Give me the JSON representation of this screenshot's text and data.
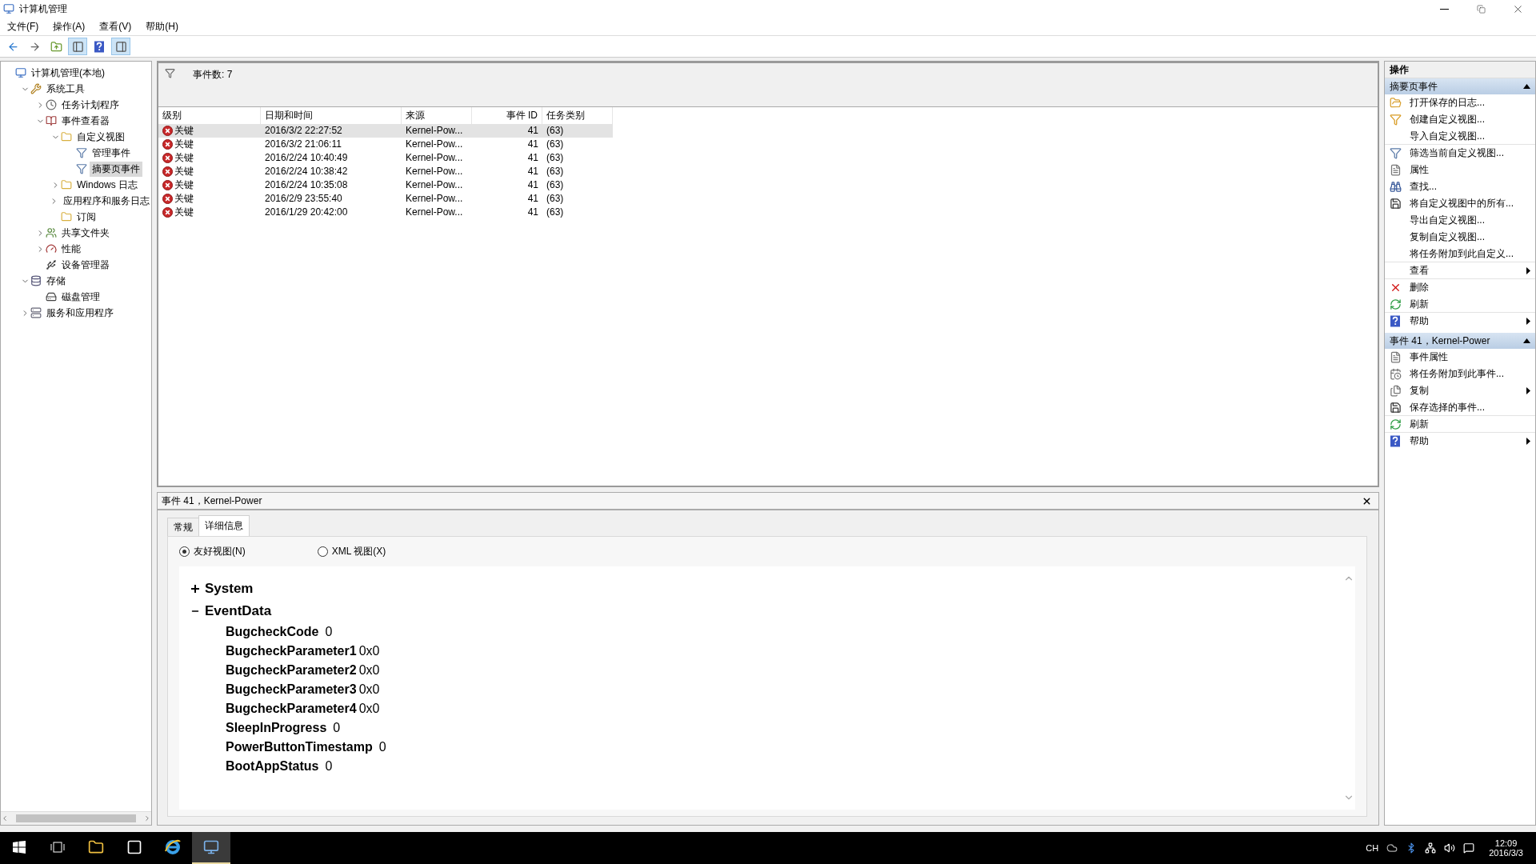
{
  "window": {
    "title": "计算机管理"
  },
  "menu": [
    "文件(F)",
    "操作(A)",
    "查看(V)",
    "帮助(H)"
  ],
  "toolbar": [
    {
      "pressed": false
    },
    {
      "pressed": false
    },
    {
      "pressed": false
    },
    {
      "pressed": true
    },
    {
      "pressed": false
    },
    {
      "pressed": true
    }
  ],
  "tree": [
    {
      "label": "计算机管理(本地)",
      "selected": false,
      "children": [
        {
          "label": "系统工具",
          "expanded": true,
          "selected": false,
          "children": [
            {
              "label": "任务计划程序",
              "expanded": false,
              "selected": false
            },
            {
              "label": "事件查看器",
              "expanded": true,
              "selected": false,
              "children": [
                {
                  "label": "自定义视图",
                  "expanded": true,
                  "selected": false,
                  "children": [
                    {
                      "label": "管理事件",
                      "selected": false
                    },
                    {
                      "label": "摘要页事件",
                      "selected": true
                    }
                  ]
                },
                {
                  "label": "Windows 日志",
                  "expanded": false,
                  "selected": false
                },
                {
                  "label": "应用程序和服务日志",
                  "expanded": false,
                  "selected": false
                },
                {
                  "label": "订阅",
                  "selected": false
                }
              ]
            },
            {
              "label": "共享文件夹",
              "expanded": false,
              "selected": false
            },
            {
              "label": "性能",
              "expanded": false,
              "selected": false
            },
            {
              "label": "设备管理器",
              "selected": false
            }
          ]
        },
        {
          "label": "存储",
          "expanded": true,
          "selected": false,
          "children": [
            {
              "label": "磁盘管理",
              "selected": false
            }
          ]
        },
        {
          "label": "服务和应用程序",
          "expanded": false,
          "selected": false
        }
      ]
    }
  ],
  "events": {
    "count_label": "事件数: 7",
    "columns": [
      "级别",
      "日期和时间",
      "来源",
      "事件 ID",
      "任务类别"
    ],
    "rows": [
      {
        "level": "关键",
        "datetime": "2016/3/2 22:27:52",
        "source": "Kernel-Pow...",
        "event_id": "41",
        "task_category": "(63)",
        "selected": true
      },
      {
        "level": "关键",
        "datetime": "2016/3/2 21:06:11",
        "source": "Kernel-Pow...",
        "event_id": "41",
        "task_category": "(63)",
        "selected": false
      },
      {
        "level": "关键",
        "datetime": "2016/2/24 10:40:49",
        "source": "Kernel-Pow...",
        "event_id": "41",
        "task_category": "(63)",
        "selected": false
      },
      {
        "level": "关键",
        "datetime": "2016/2/24 10:38:42",
        "source": "Kernel-Pow...",
        "event_id": "41",
        "task_category": "(63)",
        "selected": false
      },
      {
        "level": "关键",
        "datetime": "2016/2/24 10:35:08",
        "source": "Kernel-Pow...",
        "event_id": "41",
        "task_category": "(63)",
        "selected": false
      },
      {
        "level": "关键",
        "datetime": "2016/2/9 23:55:40",
        "source": "Kernel-Pow...",
        "event_id": "41",
        "task_category": "(63)",
        "selected": false
      },
      {
        "level": "关键",
        "datetime": "2016/1/29 20:42:00",
        "source": "Kernel-Pow...",
        "event_id": "41",
        "task_category": "(63)",
        "selected": false
      }
    ]
  },
  "details": {
    "title": "事件 41，Kernel-Power",
    "tabs": [
      {
        "label": "常规",
        "selected": false
      },
      {
        "label": "详细信息",
        "selected": true
      }
    ],
    "views": [
      {
        "label": "友好视图(N)",
        "selected": true
      },
      {
        "label": "XML 视图(X)",
        "selected": false
      }
    ],
    "nodes": [
      {
        "label": "System",
        "expanded": false
      },
      {
        "label": "EventData",
        "expanded": true,
        "fields": [
          {
            "name": "BugcheckCode",
            "value": "0"
          },
          {
            "name": "BugcheckParameter1",
            "value": "0x0"
          },
          {
            "name": "BugcheckParameter2",
            "value": "0x0"
          },
          {
            "name": "BugcheckParameter3",
            "value": "0x0"
          },
          {
            "name": "BugcheckParameter4",
            "value": "0x0"
          },
          {
            "name": "SleepInProgress",
            "value": "0"
          },
          {
            "name": "PowerButtonTimestamp",
            "value": "0"
          },
          {
            "name": "BootAppStatus",
            "value": "0"
          }
        ]
      }
    ]
  },
  "actions": {
    "title": "操作",
    "sections": [
      {
        "title": "摘要页事件",
        "expanded": true,
        "items": [
          {
            "label": "打开保存的日志...",
            "submenu": false,
            "separator_after": false
          },
          {
            "label": "创建自定义视图...",
            "submenu": false,
            "separator_after": false
          },
          {
            "label": "导入自定义视图...",
            "submenu": false,
            "separator_after": true
          },
          {
            "label": "筛选当前自定义视图...",
            "submenu": false,
            "separator_after": false
          },
          {
            "label": "属性",
            "submenu": false,
            "separator_after": false
          },
          {
            "label": "查找...",
            "submenu": false,
            "separator_after": false
          },
          {
            "label": "将自定义视图中的所有...",
            "submenu": false,
            "separator_after": false
          },
          {
            "label": "导出自定义视图...",
            "submenu": false,
            "separator_after": false
          },
          {
            "label": "复制自定义视图...",
            "submenu": false,
            "separator_after": false
          },
          {
            "label": "将任务附加到此自定义...",
            "submenu": false,
            "separator_after": true
          },
          {
            "label": "查看",
            "submenu": true,
            "separator_after": true
          },
          {
            "label": "删除",
            "submenu": false,
            "separator_after": false
          },
          {
            "label": "刷新",
            "submenu": false,
            "separator_after": true
          },
          {
            "label": "帮助",
            "submenu": true,
            "separator_after": false
          }
        ]
      },
      {
        "title": "事件 41，Kernel-Power",
        "expanded": true,
        "items": [
          {
            "label": "事件属性",
            "submenu": false,
            "separator_after": false
          },
          {
            "label": "将任务附加到此事件...",
            "submenu": false,
            "separator_after": false
          },
          {
            "label": "复制",
            "submenu": true,
            "separator_after": false
          },
          {
            "label": "保存选择的事件...",
            "submenu": false,
            "separator_after": true
          },
          {
            "label": "刷新",
            "submenu": false,
            "separator_after": true
          },
          {
            "label": "帮助",
            "submenu": true,
            "separator_after": false
          }
        ]
      }
    ]
  },
  "taskbar": {
    "apps": [
      {
        "selected": false
      },
      {
        "selected": false
      },
      {
        "selected": false
      },
      {
        "selected": true
      }
    ],
    "language": "CH",
    "time": "12:09",
    "date": "2016/3/3"
  }
}
